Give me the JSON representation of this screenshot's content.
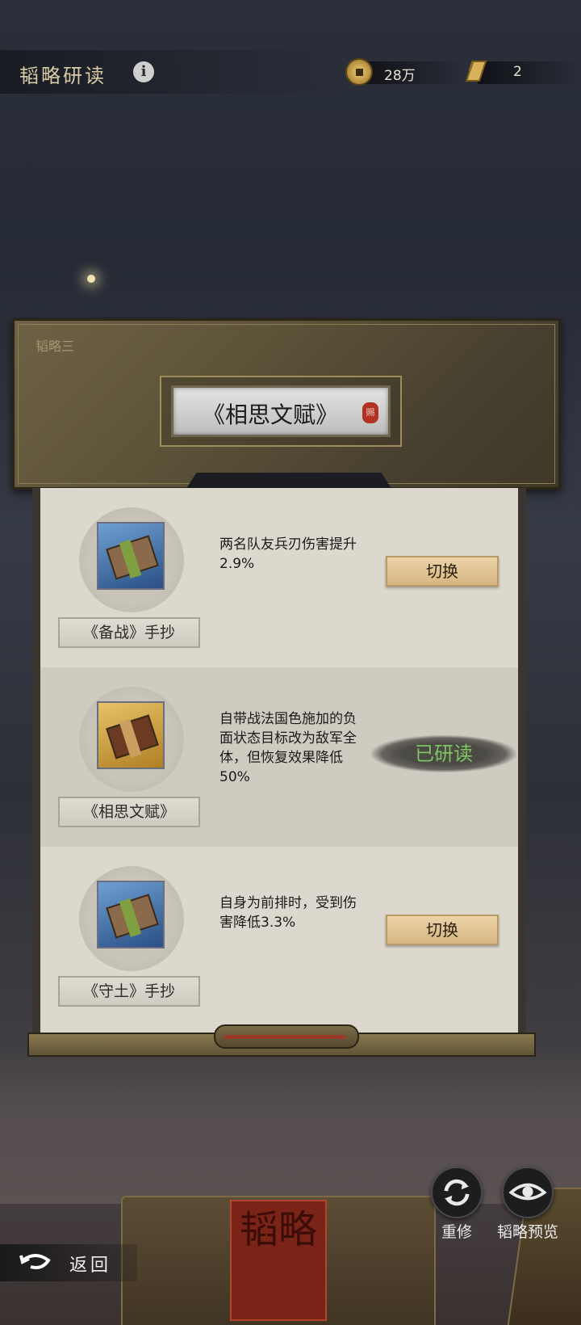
{
  "header": {
    "title": "韬略研读",
    "info_icon": "info-icon",
    "coins": {
      "icon": "coin-icon",
      "value": "28万"
    },
    "scrolls": {
      "icon": "scroll-icon",
      "value": "2"
    }
  },
  "panel": {
    "subtitle": "韬略三",
    "active_title": "《相思文赋》",
    "seal_text": "赐"
  },
  "items": [
    {
      "name": "《备战》手抄",
      "desc": "两名队友兵刃伤害提升2.9%",
      "button": "切换",
      "icon_color": "blue"
    },
    {
      "name": "《相思文赋》",
      "desc": "自带战法国色施加的负面状态目标改为敌军全体，但恢复效果降低50%",
      "status": "已研读",
      "icon_color": "gold"
    },
    {
      "name": "《守土》手抄",
      "desc": "自身为前排时，受到伤害降低3.3%",
      "button": "切换",
      "icon_color": "blue"
    }
  ],
  "actions": {
    "retrain": "重修",
    "preview": "韬略预览"
  },
  "background_book_label": "韬略",
  "back": {
    "label": "返回"
  },
  "colors": {
    "accent_gold": "#d6b682",
    "studied_green": "#7fc460",
    "panel": "#5c5238"
  }
}
